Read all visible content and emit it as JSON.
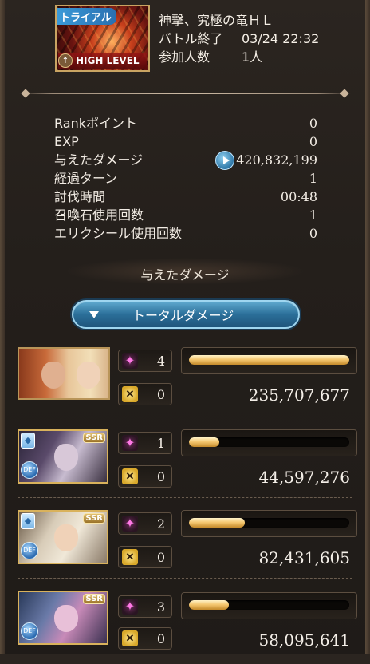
{
  "quest": {
    "trial_label": "トライアル",
    "high_level_label": "HIGH LEVEL",
    "name": "神撃、究極の竜ＨＬ",
    "rows": [
      {
        "label": "バトル終了",
        "value": "03/24 22:32"
      },
      {
        "label": "参加人数",
        "value": "1人"
      }
    ]
  },
  "stats": [
    {
      "label": "Rankポイント",
      "value": "0"
    },
    {
      "label": "EXP",
      "value": "0"
    },
    {
      "label": "与えたダメージ",
      "value": "420,832,199"
    },
    {
      "label": "経過ターン",
      "value": "1"
    },
    {
      "label": "討伐時間",
      "value": "00:48"
    },
    {
      "label": "召喚石使用回数",
      "value": "1"
    },
    {
      "label": "エリクシール使用回数",
      "value": "0"
    }
  ],
  "section_title": "与えたダメージ",
  "total_button_label": "トータルダメージ",
  "characters": [
    {
      "skill_count": "4",
      "ougi_count": "0",
      "damage": "235,707,677",
      "share": 1.0,
      "ssr": "",
      "class_label": ""
    },
    {
      "skill_count": "1",
      "ougi_count": "0",
      "damage": "44,597,276",
      "share": 0.19,
      "ssr": "SSR",
      "class_label": "DEF"
    },
    {
      "skill_count": "2",
      "ougi_count": "0",
      "damage": "82,431,605",
      "share": 0.35,
      "ssr": "SSR",
      "class_label": "DEF"
    },
    {
      "skill_count": "3",
      "ougi_count": "0",
      "damage": "58,095,641",
      "share": 0.25,
      "ssr": "SSR",
      "class_label": "DEF"
    }
  ],
  "icons": {
    "skill": "skill-sparkle-icon",
    "ougi": "charge-attack-icon",
    "play": "play-icon"
  },
  "colors": {
    "bar_fill": "#f5c872",
    "button_blue": "#2b6f99",
    "skill_pink": "#ff79e6"
  }
}
